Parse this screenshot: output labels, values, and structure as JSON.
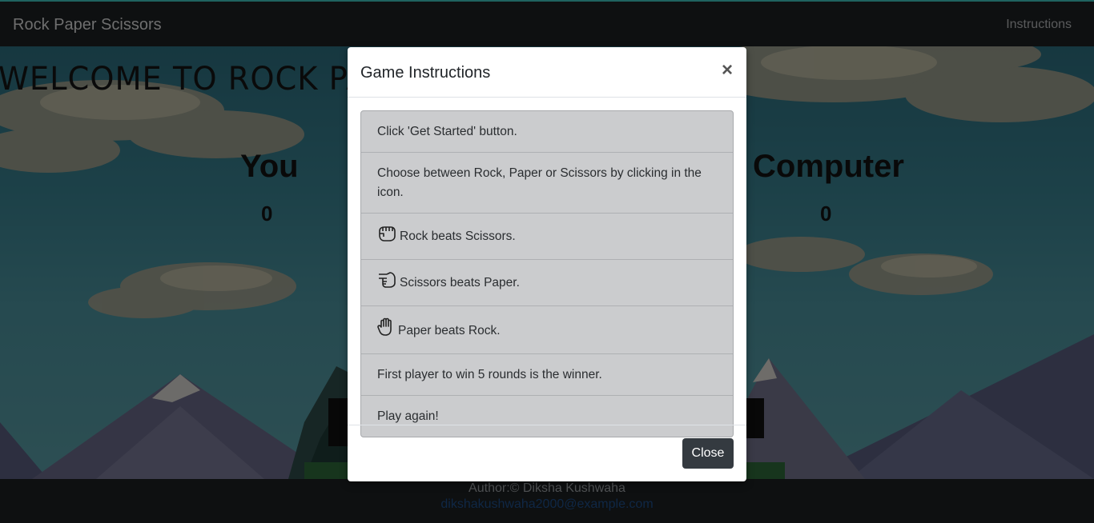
{
  "navbar": {
    "brand": "Rock Paper Scissors",
    "instructions_link": "Instructions"
  },
  "main": {
    "welcome": "WELCOME TO ROCK PAPER SCISSORS",
    "player_label": "You",
    "player_score": "0",
    "computer_label": "Computer",
    "computer_score": "0"
  },
  "footer": {
    "author": "Author:© Diksha Kushwaha",
    "email": "dikshakushwaha2000@example.com"
  },
  "modal": {
    "title": "Game Instructions",
    "close_symbol": "×",
    "items": [
      {
        "text": "Click 'Get Started' button.",
        "icon": null
      },
      {
        "text": "Choose between Rock, Paper or Scissors by clicking in the icon.",
        "icon": null
      },
      {
        "text": "Rock beats Scissors.",
        "icon": "rock-hand-icon"
      },
      {
        "text": "Scissors beats Paper.",
        "icon": "scissors-hand-icon"
      },
      {
        "text": "Paper beats Rock.",
        "icon": "paper-hand-icon"
      },
      {
        "text": "First player to win 5 rounds is the winner.",
        "icon": null
      },
      {
        "text": "Play again!",
        "icon": null
      }
    ],
    "close_button": "Close"
  },
  "colors": {
    "navbar": "#1c2023",
    "accent_line": "#3fc7c0",
    "sky": "#3a8392",
    "button_dark": "#343a40",
    "list_bg": "#cbccce"
  }
}
